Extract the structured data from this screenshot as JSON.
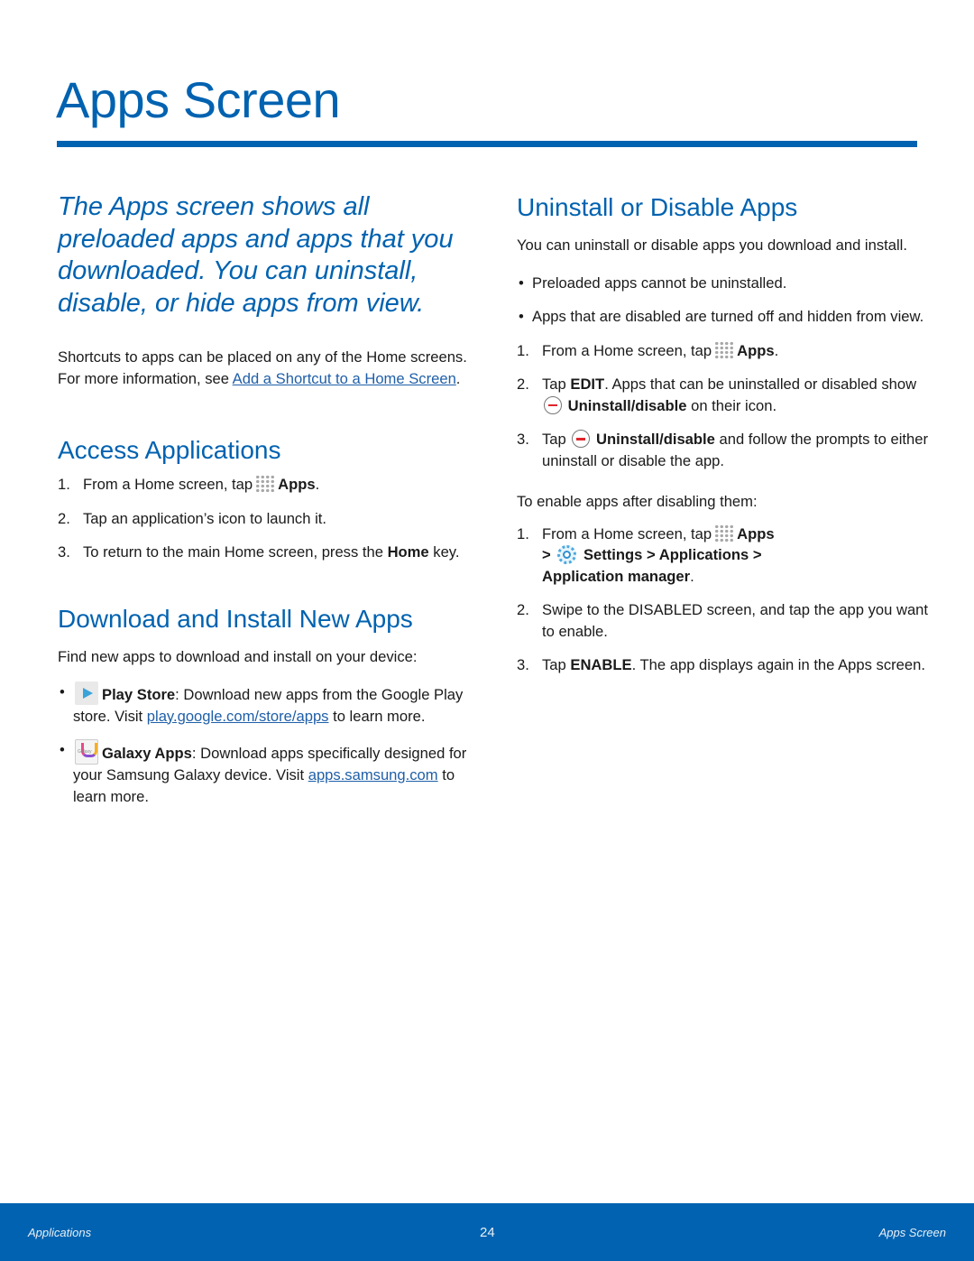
{
  "page": {
    "title": "Apps Screen",
    "accent_color": "#0062b0"
  },
  "left": {
    "intro": "The Apps screen shows all preloaded apps and apps that you downloaded. You can uninstall, disable, or hide apps from view.",
    "shortcuts_text": "Shortcuts to apps can be placed on any of the Home screens. For more information, see ",
    "shortcuts_link": "Add a Shortcut to a Home Screen",
    "shortcuts_end": ".",
    "access": {
      "heading": "Access Applications",
      "steps": [
        {
          "num": "1.",
          "pre": "From a Home screen, tap",
          "icon": "apps-grid-icon",
          "bold": "Apps",
          "post": "."
        },
        {
          "num": "2.",
          "text": "Tap an application’s icon to launch it."
        },
        {
          "num": "3.",
          "pre": "To return to the main Home screen, press the ",
          "bold": "Home",
          "post": " key."
        }
      ]
    },
    "download": {
      "heading": "Download and Install New Apps",
      "intro": "Find new apps to download and install on your device:",
      "bullets": [
        {
          "icon": "play-store-icon",
          "bold": "Play Store",
          "text": ": Download new apps from the Google Play store. Visit ",
          "link": "play.google.com/store/apps",
          "post": " to learn more."
        },
        {
          "icon": "galaxy-apps-icon",
          "bold": "Galaxy Apps",
          "text": ": Download apps specifically designed for your Samsung Galaxy device. Visit ",
          "link": "apps.samsung.com",
          "post": " to learn more."
        }
      ]
    }
  },
  "right": {
    "heading": "Uninstall or Disable Apps",
    "intro": "You can uninstall or disable apps you download and install.",
    "bullets": [
      "Preloaded apps cannot be uninstalled.",
      "Apps that are disabled are turned off and hidden from view."
    ],
    "steps": [
      {
        "num": "1.",
        "pre": "From a Home screen, tap",
        "icon": "apps-grid-icon",
        "bold": "Apps",
        "post": "."
      },
      {
        "num": "2.",
        "pre": "Tap ",
        "bold": "EDIT",
        "mid": ". Apps that can be uninstalled or disabled show",
        "icon": "minus-circle-icon",
        "bold2": "Uninstall/disable",
        "post": " on their icon."
      },
      {
        "num": "3.",
        "pre": "Tap",
        "icon": "minus-circle-icon",
        "bold": "Uninstall/disable",
        "post": " and follow the prompts to either uninstall or disable the app."
      }
    ],
    "enable_intro": "To enable apps after disabling them:",
    "enable_steps": [
      {
        "num": "1.",
        "pre": "From a Home screen, tap",
        "bold": "Apps",
        "sep1": ">",
        "bold2": "Settings",
        "sep2": " > ",
        "bold3": "Applications",
        "sep3": " > ",
        "bold4": "Application manager",
        "post": "."
      },
      {
        "num": "2.",
        "text": "Swipe to the DISABLED screen, and tap the app you want to enable."
      },
      {
        "num": "3.",
        "pre": "Tap ",
        "bold": "ENABLE",
        "post": ". The app displays again in the Apps screen."
      }
    ]
  },
  "footer": {
    "left": "Applications",
    "page_number": "24",
    "right": "Apps Screen"
  }
}
